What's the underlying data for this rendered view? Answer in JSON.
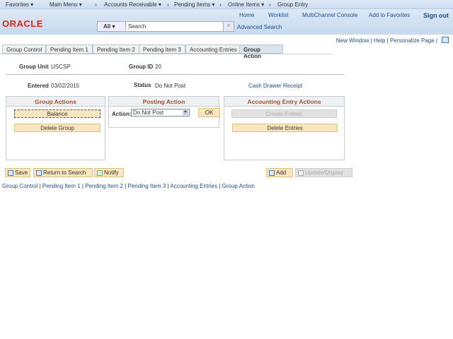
{
  "topnav": [
    "Favorites ▾",
    "Main Menu ▾",
    "›",
    "Accounts Receivable ▾",
    "›",
    "Pending Items ▾",
    "›",
    "Online Items ▾",
    "›",
    "Group Entry"
  ],
  "header": {
    "logo": "ORACLE",
    "links": [
      "Home",
      "Worklist",
      "MultiChannel Console",
      "Add to Favorites"
    ],
    "signout": "Sign out",
    "search_scope": "All",
    "search_placeholder": "Search",
    "go": "»",
    "advanced": "Advanced Search"
  },
  "pagelinks": {
    "new_window": "New Window",
    "help": "Help",
    "personalize": "Personalize Page"
  },
  "tabs": [
    "Group Control",
    "Pending Item 1",
    "Pending Item 2",
    "Pending Item 3",
    "Accounting Entries",
    "Group Action"
  ],
  "fields": {
    "group_unit_label": "Group Unit",
    "group_unit": "USCSP",
    "group_id_label": "Group ID",
    "group_id": "20",
    "entered_label": "Entered",
    "entered": "03/02/2015",
    "status_label": "Status",
    "status": "Do Not Post",
    "type": "Cash Drawer Receipt"
  },
  "group_actions": {
    "title": "Group Actions",
    "balance": "Balance",
    "delete": "Delete Group"
  },
  "posting": {
    "title": "Posting Action",
    "label": "Action:",
    "value": "Do Not Post",
    "ok": "OK"
  },
  "accounting": {
    "title": "Accounting Entry Actions",
    "create": "Create Entries",
    "delete": "Delete Entries"
  },
  "toolbar": {
    "save": "Save",
    "return": "Return to Search",
    "notify": "Notify",
    "add": "Add",
    "update": "Update/Display"
  },
  "bottom_links": [
    "Group Control",
    "Pending Item 1",
    "Pending Item 2",
    "Pending Item 3",
    "Accounting Entries",
    "Group Action"
  ]
}
